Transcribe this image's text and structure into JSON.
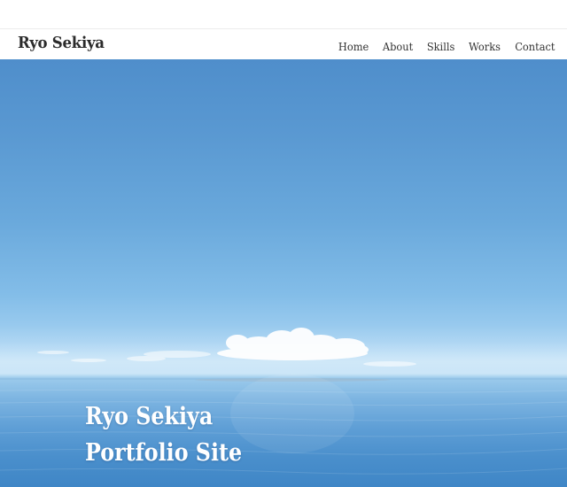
{
  "header": {
    "brand": "Ryo Sekiya",
    "nav": [
      {
        "label": "Home"
      },
      {
        "label": "About"
      },
      {
        "label": "Skills"
      },
      {
        "label": "Works"
      },
      {
        "label": "Contact"
      }
    ]
  },
  "hero": {
    "title_line1": "Ryo Sekiya",
    "title_line2": "Portfolio Site"
  }
}
